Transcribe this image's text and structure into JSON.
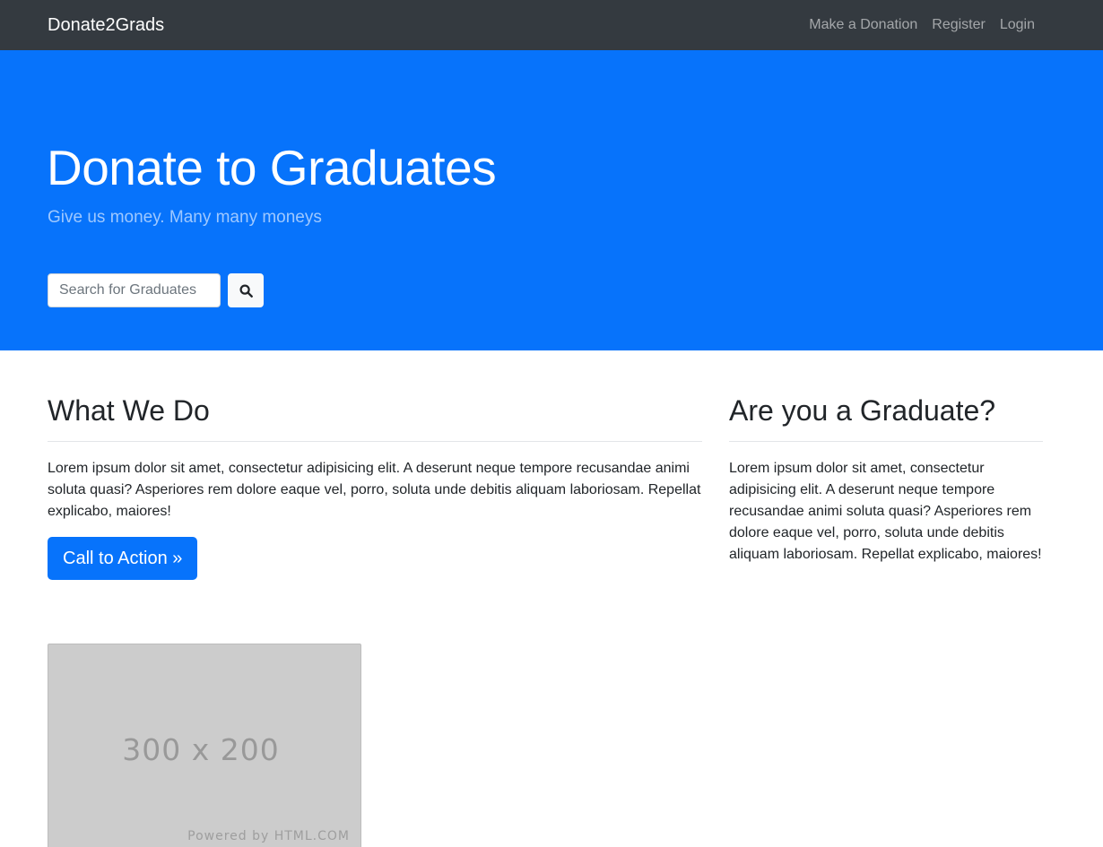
{
  "navbar": {
    "brand": "Donate2Grads",
    "links": [
      "Make a Donation",
      "Register",
      "Login"
    ]
  },
  "hero": {
    "title": "Donate to Graduates",
    "subtitle": "Give us money. Many many moneys",
    "search": {
      "placeholder": "Search for Graduates",
      "value": "",
      "button_icon": "search-icon"
    }
  },
  "what_we_do": {
    "title": "What We Do",
    "text": "Lorem ipsum dolor sit amet, consectetur adipisicing elit. A deserunt neque tempore recusandae animi soluta quasi? Asperiores rem dolore eaque vel, porro, soluta unde debitis aliquam laboriosam. Repellat explicabo, maiores!",
    "cta_label": "Call to Action »"
  },
  "graduate": {
    "title": "Are you a Graduate?",
    "text": "Lorem ipsum dolor sit amet, consectetur adipisicing elit. A deserunt neque tempore recusandae animi soluta quasi? Asperiores rem dolore eaque vel, porro, soluta unde debitis aliquam laboriosam. Repellat explicabo, maiores!"
  },
  "placeholder_image": {
    "size_label": "300 x 200",
    "credit": "Powered by HTML.COM"
  },
  "colors": {
    "navbar_bg": "#343a40",
    "hero_bg": "#0773fb",
    "primary": "#0773fb"
  }
}
